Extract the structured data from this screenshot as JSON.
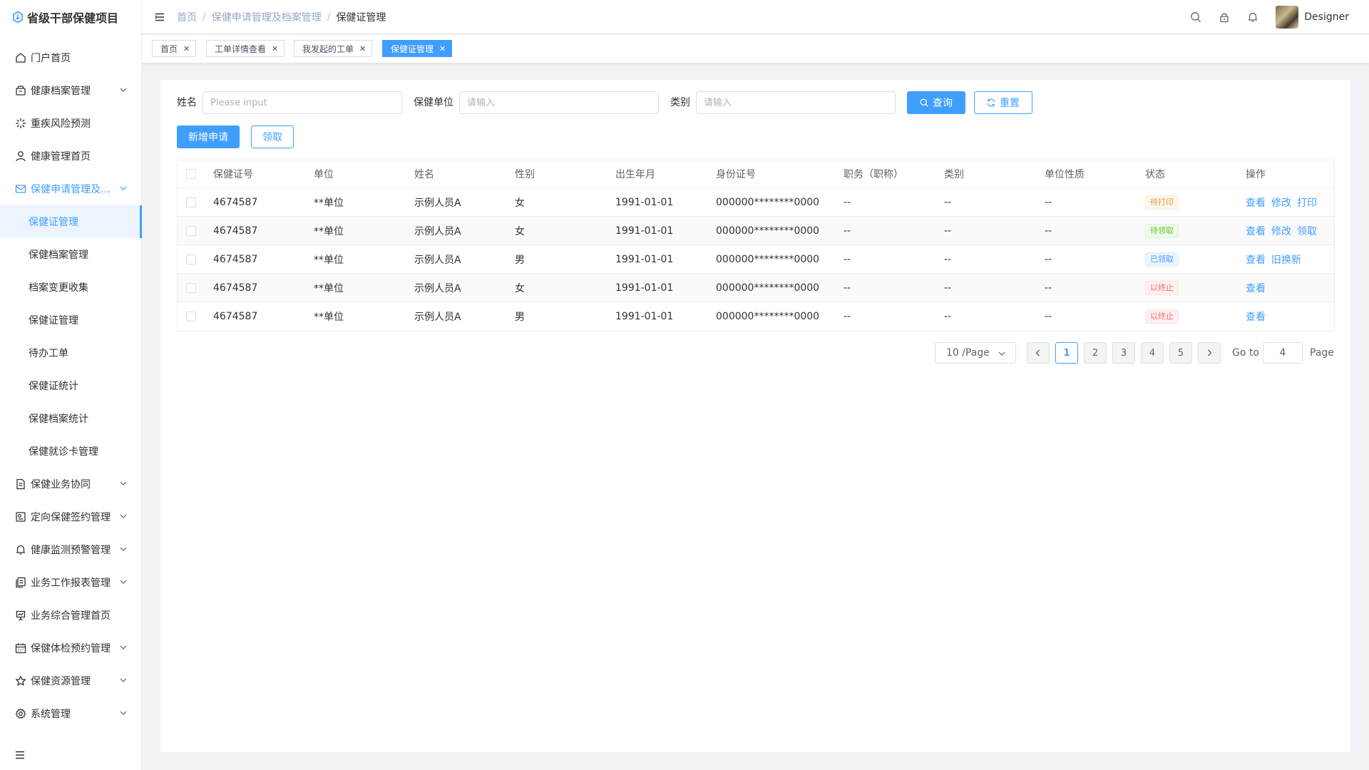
{
  "app": {
    "title": "省级干部保健项目"
  },
  "sidebar": {
    "items": [
      {
        "label": "门户首页",
        "icon": "home-icon"
      },
      {
        "label": "健康档案管理",
        "icon": "archive-icon"
      },
      {
        "label": "重疾风险预测",
        "icon": "spark-icon"
      },
      {
        "label": "健康管理首页",
        "icon": "user-icon"
      },
      {
        "label": "保健申请管理及…",
        "icon": "mail-icon"
      }
    ],
    "submenu": [
      {
        "label": "保健证管理"
      },
      {
        "label": "保健档案管理"
      },
      {
        "label": "档案变更收集"
      },
      {
        "label": "保健证管理"
      },
      {
        "label": "待办工单"
      },
      {
        "label": "保健证统计"
      },
      {
        "label": "保健档案统计"
      },
      {
        "label": "保健就诊卡管理"
      }
    ],
    "items2": [
      {
        "label": "保健业务协同"
      },
      {
        "label": "定向保健签约管理"
      },
      {
        "label": "健康监测预警管理"
      },
      {
        "label": "业务工作报表管理"
      },
      {
        "label": "业务综合管理首页"
      },
      {
        "label": "保健体检预约管理"
      },
      {
        "label": "保健资源管理"
      },
      {
        "label": "系统管理"
      }
    ]
  },
  "header": {
    "breadcrumb": [
      "首页",
      "保健申请管理及档案管理",
      "保健证管理"
    ],
    "username": "Designer"
  },
  "tags": [
    "首页",
    "工单详情查看",
    "我发起的工单",
    "保健证管理"
  ],
  "search": {
    "name_label": "姓名",
    "name_placeholder": "Please input",
    "unit_label": "保健单位",
    "unit_placeholder": "请输入",
    "type_label": "类别",
    "type_placeholder": "请输入",
    "query_label": "查询",
    "reset_label": "重置",
    "add_label": "新增申请",
    "claim_label": "领取"
  },
  "table": {
    "headers": [
      "保健证号",
      "单位",
      "姓名",
      "性别",
      "出生年月",
      "身份证号",
      "职务（职称）",
      "类别",
      "单位性质",
      "状态",
      "操作"
    ],
    "rows": [
      {
        "c0": "4674587",
        "c1": "**单位",
        "c2": "示例人员A",
        "c3": "女",
        "c4": "1991-01-01",
        "c5": "000000********0000",
        "c6": "--",
        "c7": "--",
        "c8": "--",
        "status": "待打印",
        "ops": [
          "查看",
          "修改",
          "打印"
        ]
      },
      {
        "c0": "4674587",
        "c1": "**单位",
        "c2": "示例人员A",
        "c3": "女",
        "c4": "1991-01-01",
        "c5": "000000********0000",
        "c6": "--",
        "c7": "--",
        "c8": "--",
        "status": "待领取",
        "ops": [
          "查看",
          "修改",
          "领取"
        ]
      },
      {
        "c0": "4674587",
        "c1": "**单位",
        "c2": "示例人员A",
        "c3": "男",
        "c4": "1991-01-01",
        "c5": "000000********0000",
        "c6": "--",
        "c7": "--",
        "c8": "--",
        "status": "已领取",
        "ops": [
          "查看",
          "旧换新"
        ]
      },
      {
        "c0": "4674587",
        "c1": "**单位",
        "c2": "示例人员A",
        "c3": "女",
        "c4": "1991-01-01",
        "c5": "000000********0000",
        "c6": "--",
        "c7": "--",
        "c8": "--",
        "status": "以终止",
        "ops": [
          "查看"
        ]
      },
      {
        "c0": "4674587",
        "c1": "**单位",
        "c2": "示例人员A",
        "c3": "男",
        "c4": "1991-01-01",
        "c5": "000000********0000",
        "c6": "--",
        "c7": "--",
        "c8": "--",
        "status": "以终止",
        "ops": [
          "查看"
        ]
      }
    ]
  },
  "pagination": {
    "page_size": "10 /Page",
    "pages": [
      "1",
      "2",
      "3",
      "4",
      "5"
    ],
    "current": "1",
    "goto_label": "Go to",
    "goto_value": "4",
    "page_label": "Page"
  },
  "colors": {
    "accent": "#409eff",
    "warn": "#e6a23c",
    "success": "#67c23a",
    "danger": "#f56c6c"
  }
}
